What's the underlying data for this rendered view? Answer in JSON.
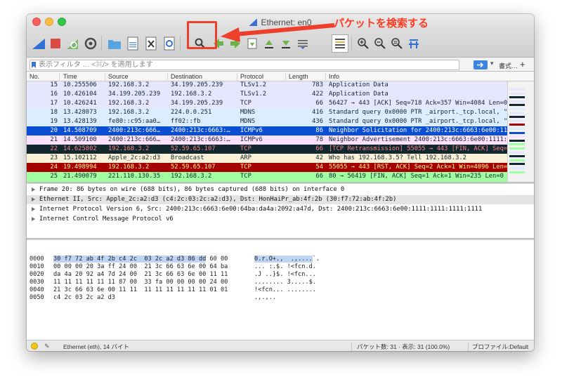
{
  "window": {
    "title": "Ethernet: en0"
  },
  "annotation": {
    "label": "パケットを検索する",
    "color": "#ee3f2c"
  },
  "toolbar": {
    "icons": [
      "shark-fin-start-icon",
      "stop-capture-icon",
      "restart-capture-icon",
      "capture-options-icon",
      "open-file-icon",
      "save-file-icon",
      "close-file-icon",
      "reload-file-icon",
      "find-packet-icon",
      "go-back-icon",
      "go-forward-icon",
      "go-to-packet-icon",
      "go-first-icon",
      "go-last-icon",
      "auto-scroll-icon",
      "colorize-icon",
      "zoom-in-icon",
      "zoom-out-icon",
      "normal-size-icon",
      "resize-columns-icon"
    ]
  },
  "filter": {
    "placeholder": "表示フィルタ … <⌘/> を適用します",
    "expression_label": "書式…",
    "add_label": "+",
    "dropdown": "▾"
  },
  "packet_list": {
    "columns": [
      "No.",
      "Time",
      "Source",
      "Destination",
      "Protocol",
      "Length",
      "Info"
    ],
    "rows": [
      {
        "no": "15",
        "time": "10.255506",
        "src": "192.168.3.2",
        "dst": "34.199.205.239",
        "proto": "TLSv1.2",
        "len": "783",
        "info": "Application Data",
        "bg": "#e7e6ff",
        "fg": "#12272e"
      },
      {
        "no": "16",
        "time": "10.426104",
        "src": "34.199.205.239",
        "dst": "192.168.3.2",
        "proto": "TLSv1.2",
        "len": "422",
        "info": "Application Data",
        "bg": "#e7e6ff",
        "fg": "#12272e"
      },
      {
        "no": "17",
        "time": "10.426241",
        "src": "192.168.3.2",
        "dst": "34.199.205.239",
        "proto": "TCP",
        "len": "66",
        "info": "56427 → 443 [ACK] Seq=718 Ack=357 Win=4084 Len=0",
        "bg": "#e7e6ff",
        "fg": "#12272e"
      },
      {
        "no": "18",
        "time": "13.428073",
        "src": "192.168.3.2",
        "dst": "224.0.0.251",
        "proto": "MDNS",
        "len": "416",
        "info": "Standard query 0x0000 PTR _airport._tcp.local, \"QM\"",
        "bg": "#daeeff",
        "fg": "#12272e"
      },
      {
        "no": "19",
        "time": "13.428139",
        "src": "fe80::c95:aa0…",
        "dst": "ff02::fb",
        "proto": "MDNS",
        "len": "436",
        "info": "Standard query 0x0000 PTR _airport._tcp.local, \"QM\"",
        "bg": "#daeeff",
        "fg": "#12272e"
      },
      {
        "no": "20",
        "time": "14.508709",
        "src": "2400:213c:666…",
        "dst": "2400:213c:6663:…",
        "proto": "ICMPv6",
        "len": "86",
        "info": "Neighbor Solicitation for 2400:213c:6663:6e00:111",
        "bg": "#0a4fd3",
        "fg": "#ffffff"
      },
      {
        "no": "21",
        "time": "14.509100",
        "src": "2400:213c:666…",
        "dst": "2400:213c:6663:…",
        "proto": "ICMPv6",
        "len": "78",
        "info": "Neighbor Advertisement 2400:213c:6663:6e00:1111:11",
        "bg": "#fce0ff",
        "fg": "#12272e"
      },
      {
        "no": "22",
        "time": "14.625802",
        "src": "192.168.3.2",
        "dst": "52.59.65.107",
        "proto": "TCP",
        "len": "66",
        "info": "[TCP Retransmission] 55055 → 443 [FIN, ACK] Seq=1",
        "bg": "#12272e",
        "fg": "#f78787"
      },
      {
        "no": "23",
        "time": "15.102112",
        "src": "Apple_2c:a2:d3",
        "dst": "Broadcast",
        "proto": "ARP",
        "len": "42",
        "info": "Who has 192.168.3.5? Tell 192.168.3.2",
        "bg": "#faf0d7",
        "fg": "#12272e"
      },
      {
        "no": "24",
        "time": "19.498994",
        "src": "192.168.3.2",
        "dst": "52.59.65.107",
        "proto": "TCP",
        "len": "54",
        "info": "55055 → 443 [RST, ACK] Seq=2 Ack=1 Win=4096 Len=0",
        "bg": "#a40000",
        "fg": "#fffc9c"
      },
      {
        "no": "25",
        "time": "21.490079",
        "src": "221.110.130.35",
        "dst": "192.168.3.2",
        "proto": "TCP",
        "len": "66",
        "info": "80 → 56419 [FIN, ACK] Seq=1 Ack=1 Win=235 Len=0 TS",
        "bg": "#a0ffa0",
        "fg": "#12272e"
      },
      {
        "no": "26",
        "time": "21.490241",
        "src": "192.168.3.2",
        "dst": "221.110.130.35",
        "proto": "TCP",
        "len": "66",
        "info": "56419 → 80 [ACK] Seq=1 Ack=2 Win=4096 Len=0 TSval",
        "bg": "#a0ffa0",
        "fg": "#12272e"
      }
    ]
  },
  "details": [
    {
      "text": "Frame 20: 86 bytes on wire (688 bits), 86 bytes captured (688 bits) on interface 0",
      "bg": "#ffffff"
    },
    {
      "text": "Ethernet II, Src: Apple_2c:a2:d3 (c4:2c:03:2c:a2:d3), Dst: HonHaiPr_ab:4f:2b (30:f7:72:ab:4f:2b)",
      "bg": "#e4e4e4"
    },
    {
      "text": "Internet Protocol Version 6, Src: 2400:213c:6663:6e00:64ba:da4a:2092:a47d, Dst: 2400:213c:6663:6e00:1111:1111:1111:1111",
      "bg": "#ffffff"
    },
    {
      "text": "Internet Control Message Protocol v6",
      "bg": "#ffffff"
    }
  ],
  "bytes": [
    {
      "off": "0000",
      "hex_hl": "30 f7 72 ab 4f 2b c4 2c  03 2c a2 d3 86 dd",
      "hex_rest": " 60 00",
      "ascii_hl": "0.r.O+.,  .,....",
      "ascii_rest": "`."
    },
    {
      "off": "0010",
      "hex_hl": "",
      "hex_rest": "00 00 00 20 3a ff 24 00  21 3c 66 63 6e 00 64 ba",
      "ascii_hl": "",
      "ascii_rest": "... :.$. !<fcn.d."
    },
    {
      "off": "0020",
      "hex_hl": "",
      "hex_rest": "da 4a 20 92 a4 7d 24 00  21 3c 66 63 6e 00 11 11",
      "ascii_hl": "",
      "ascii_rest": ".J ..}$. !<fcn..."
    },
    {
      "off": "0030",
      "hex_hl": "",
      "hex_rest": "11 11 11 11 11 11 87 00  33 fa 00 00 00 00 24 00",
      "ascii_hl": "",
      "ascii_rest": "........ 3.....$."
    },
    {
      "off": "0040",
      "hex_hl": "",
      "hex_rest": "21 3c 66 63 6e 00 11 11  11 11 11 11 11 11 01 01",
      "ascii_hl": "",
      "ascii_rest": "!<fcn... ........"
    },
    {
      "off": "0050",
      "hex_hl": "",
      "hex_rest": "c4 2c 03 2c a2 d3",
      "ascii_hl": "",
      "ascii_rest": ".,.,.."
    }
  ],
  "status": {
    "interface": "Ethernet (eth), 14 バイト",
    "packets": "パケット数: 31 · 表示: 31 (100.0%)",
    "profile": "プロファイル:Default"
  },
  "minimap_colors": [
    "#e7e6ff",
    "#e7e6ff",
    "#12272e",
    "#e7e6ff",
    "#12272e",
    "#daeeff",
    "#e7e6ff",
    "#12272e",
    "#e7e6ff",
    "#a40000",
    "#daeeff",
    "#0a4fd3",
    "#fce0ff",
    "#12272e",
    "#a0ffa0",
    "#a0ffa0",
    "#e7e6ff",
    "#12272e",
    "#a0ffa0",
    "#12272e",
    "#e7e6ff",
    "#a0ffa0"
  ]
}
